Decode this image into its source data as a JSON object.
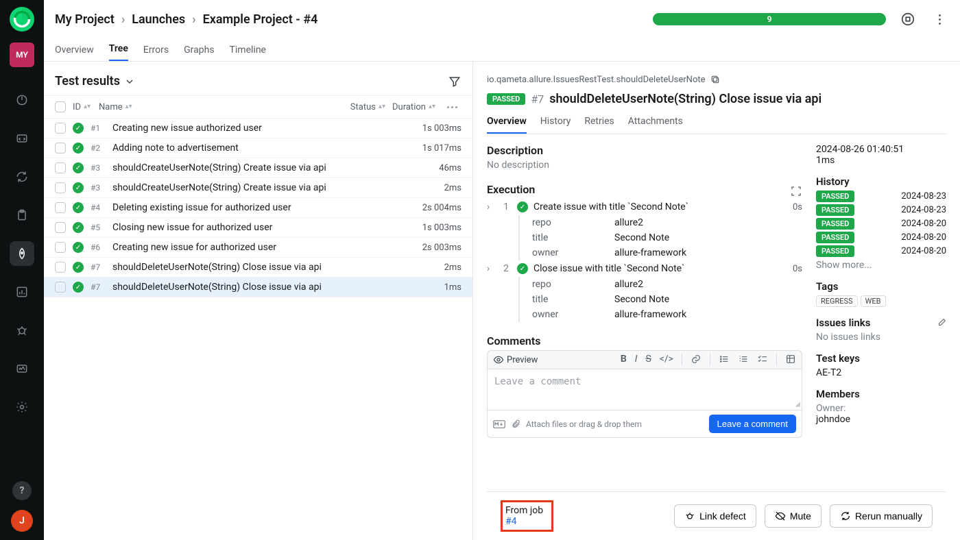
{
  "breadcrumbs": {
    "root": "My Project",
    "mid": "Launches",
    "leaf": "Example Project - #4"
  },
  "progress_count": "9",
  "top_tabs": [
    "Overview",
    "Tree",
    "Errors",
    "Graphs",
    "Timeline"
  ],
  "avatar_initials": "MY",
  "test_results_title": "Test results",
  "columns": {
    "id": "ID",
    "name": "Name",
    "status": "Status",
    "duration": "Duration"
  },
  "rows": [
    {
      "num": "#1",
      "name": "Creating new issue authorized user",
      "dur": "1s 003ms"
    },
    {
      "num": "#2",
      "name": "Adding note to advertisement",
      "dur": "1s 017ms"
    },
    {
      "num": "#3",
      "name": "shouldCreateUserNote(String) Create issue via api",
      "dur": "46ms"
    },
    {
      "num": "#3",
      "name": "shouldCreateUserNote(String) Create issue via api",
      "dur": "2ms"
    },
    {
      "num": "#4",
      "name": "Deleting existing issue for authorized user",
      "dur": "2s 004ms"
    },
    {
      "num": "#5",
      "name": "Closing new issue for authorized user",
      "dur": "1s 003ms"
    },
    {
      "num": "#6",
      "name": "Creating new issue for authorized user",
      "dur": "2s 003ms"
    },
    {
      "num": "#7",
      "name": "shouldDeleteUserNote(String) Close issue via api",
      "dur": "2ms"
    },
    {
      "num": "#7",
      "name": "shouldDeleteUserNote(String) Close issue via api",
      "dur": "1ms"
    }
  ],
  "detail": {
    "fqn": "io.qameta.allure.IssuesRestTest.shouldDeleteUserNote",
    "status": "PASSED",
    "id": "#7",
    "title": "shouldDeleteUserNote(String) Close issue via api",
    "tabs": [
      "Overview",
      "History",
      "Retries",
      "Attachments"
    ],
    "desc_title": "Description",
    "desc_text": "No description",
    "exec_title": "Execution",
    "steps": [
      {
        "n": "1",
        "name": "Create issue with title `Second Note`",
        "dur": "0s",
        "params": [
          [
            "repo",
            "allure2"
          ],
          [
            "title",
            "Second Note"
          ],
          [
            "owner",
            "allure-framework"
          ]
        ]
      },
      {
        "n": "2",
        "name": "Close issue with title `Second Note`",
        "dur": "0s",
        "params": [
          [
            "repo",
            "allure2"
          ],
          [
            "title",
            "Second Note"
          ],
          [
            "owner",
            "allure-framework"
          ]
        ]
      }
    ],
    "comments_title": "Comments",
    "preview_label": "Preview",
    "comment_placeholder": "Leave a comment",
    "attach_label": "Attach files or drag & drop them",
    "leave_btn": "Leave a comment",
    "from_job_label": "From job",
    "from_job_link": "#4",
    "link_defect": "Link defect",
    "mute": "Mute",
    "rerun": "Rerun manually"
  },
  "side": {
    "date": "2024-08-26 01:40:51",
    "dur": "1ms",
    "history_title": "History",
    "history": [
      {
        "s": "PASSED",
        "d": "2024-08-23"
      },
      {
        "s": "PASSED",
        "d": "2024-08-23"
      },
      {
        "s": "PASSED",
        "d": "2024-08-20"
      },
      {
        "s": "PASSED",
        "d": "2024-08-20"
      },
      {
        "s": "PASSED",
        "d": "2024-08-20"
      }
    ],
    "show_more": "Show more...",
    "tags_title": "Tags",
    "tags": [
      "REGRESS",
      "WEB"
    ],
    "issues_title": "Issues links",
    "issues_text": "No issues links",
    "keys_title": "Test keys",
    "keys_text": "AE-T2",
    "members_title": "Members",
    "owner_label": "Owner:",
    "owner_name": "johndoe"
  },
  "user_initial": "J"
}
